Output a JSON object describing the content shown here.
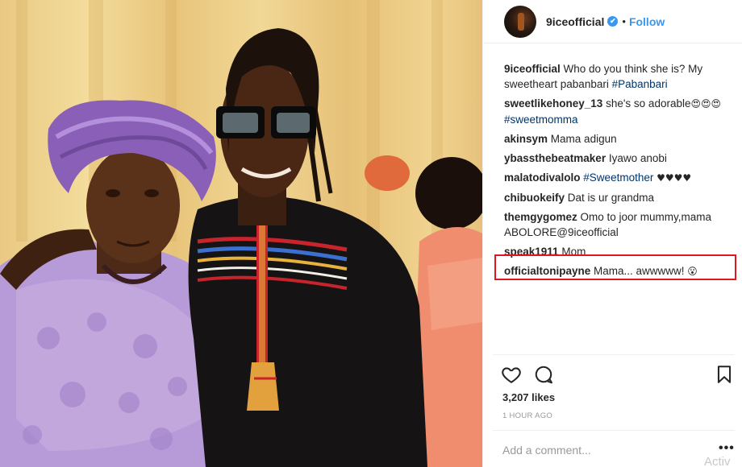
{
  "post": {
    "owner_username": "9iceofficial",
    "verified_mark": "✔",
    "separator": "•",
    "follow_label": "Follow"
  },
  "comments": [
    {
      "user": "9iceofficial",
      "text": " Who do you think she is? My sweetheart pabanbari ",
      "tag": "#Pabanbari",
      "after": ""
    },
    {
      "user": "sweetlikehoney_13",
      "text": " she's so adorable",
      "emoji": "😍😍😍",
      "tag": "#sweetmomma",
      "after": ""
    },
    {
      "user": "akinsym",
      "text": " Mama adigun"
    },
    {
      "user": "ybassthebeatmaker",
      "text": " Iyawo anobi"
    },
    {
      "user": "malatodivalolo",
      "text": " ",
      "tag": "#Sweetmother",
      "after": " ♥♥♥♥"
    },
    {
      "user": "chibuokeify",
      "text": " Dat is ur grandma"
    },
    {
      "user": "themgygomez",
      "text": " Omo to joor mummy,mama ABOLORE@9iceofficial"
    },
    {
      "user": "speak1911",
      "text": " Mom"
    },
    {
      "user": "officialtonipayne",
      "text": " Mama... awwwww! ",
      "emoji": "😮"
    }
  ],
  "actions": {
    "icons": [
      "heart-icon",
      "comment-icon",
      "bookmark-icon"
    ]
  },
  "likes_text": "3,207 likes",
  "timestamp": "1 HOUR AGO",
  "add_comment_placeholder": "Add a comment...",
  "more_label": "•••",
  "watermark": "Activ",
  "colors": {
    "link_blue": "#3897f0",
    "hashtag": "#003569",
    "highlight_border": "#e0171f"
  }
}
